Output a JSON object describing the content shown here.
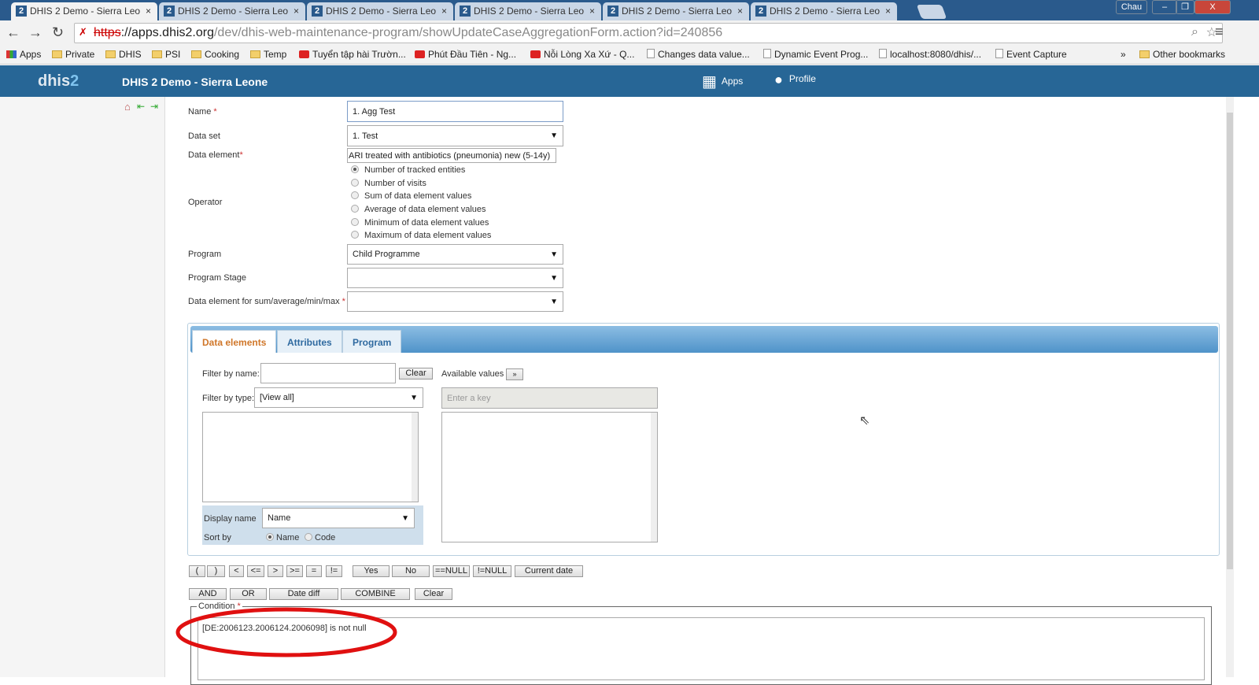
{
  "browser": {
    "tabs": [
      {
        "title": "DHIS 2 Demo - Sierra Leo",
        "active": true
      },
      {
        "title": "DHIS 2 Demo - Sierra Leo"
      },
      {
        "title": "DHIS 2 Demo - Sierra Leo"
      },
      {
        "title": "DHIS 2 Demo - Sierra Leo"
      },
      {
        "title": "DHIS 2 Demo - Sierra Leo"
      },
      {
        "title": "DHIS 2 Demo - Sierra Leo"
      }
    ],
    "favicon": "2",
    "close": "×",
    "user": "Chau",
    "url_scheme": "https",
    "url_host": "://apps.dhis2.org",
    "url_path": "/dev/dhis-web-maintenance-program/showUpdateCaseAggregationForm.action?id=240856",
    "bookmarks": [
      {
        "label": "Apps",
        "icon": "apps-grid"
      },
      {
        "label": "Private",
        "icon": "folder"
      },
      {
        "label": "DHIS",
        "icon": "folder"
      },
      {
        "label": "PSI",
        "icon": "folder"
      },
      {
        "label": "Cooking",
        "icon": "folder"
      },
      {
        "label": "Temp",
        "icon": "folder"
      },
      {
        "label": "Tuyển tập hài Trườn...",
        "icon": "youtube"
      },
      {
        "label": "Phút Đầu Tiên - Ng...",
        "icon": "youtube"
      },
      {
        "label": "Nỗi Lòng Xa Xứ - Q...",
        "icon": "youtube"
      },
      {
        "label": "Changes data value...",
        "icon": "page"
      },
      {
        "label": "Dynamic Event Prog...",
        "icon": "page"
      },
      {
        "label": "localhost:8080/dhis/...",
        "icon": "page"
      },
      {
        "label": "Event Capture",
        "icon": "page"
      }
    ],
    "more": "»",
    "other_bookmarks": "Other bookmarks"
  },
  "header": {
    "logo_main": "dhis",
    "logo_num": "2",
    "title": "DHIS 2 Demo - Sierra Leone",
    "apps": "Apps",
    "profile": "Profile"
  },
  "form": {
    "name_label": "Name",
    "name_value": "1. Agg Test",
    "dataset_label": "Data set",
    "dataset_value": "1. Test",
    "de_label": "Data element",
    "de_value": "ARI treated with antibiotics (pneumonia) new (5-14y)",
    "operator_label": "Operator",
    "operators": [
      "Number of tracked entities",
      "Number of visits",
      "Sum of data element values",
      "Average of data element values",
      "Minimum of data element values",
      "Maximum of data element values"
    ],
    "program_label": "Program",
    "program_value": "Child Programme",
    "stage_label": "Program Stage",
    "stage_value": "",
    "de_sum_label": "Data element for sum/average/min/max",
    "required": "*"
  },
  "panel": {
    "tabs": [
      "Data elements",
      "Attributes",
      "Program"
    ],
    "filter_name_label": "Filter by name:",
    "clear": "Clear",
    "available_values": "Available values",
    "move": "»",
    "filter_type_label": "Filter by type:",
    "filter_type_value": "[View all]",
    "key_placeholder": "Enter a key",
    "display_name_label": "Display name",
    "display_name_value": "Name",
    "sort_by_label": "Sort by",
    "sort_name": "Name",
    "sort_code": "Code"
  },
  "operators_row1": [
    "(",
    ")",
    "<",
    "<=",
    ">",
    ">=",
    "=",
    "!=",
    "Yes",
    "No",
    "==NULL",
    "!=NULL",
    "Current date"
  ],
  "operators_row2": [
    "AND",
    "OR",
    "Date diff",
    "COMBINE",
    "Clear"
  ],
  "condition": {
    "label": "Condition",
    "value": "[DE:2006123.2006124.2006098] is not null"
  },
  "colors": {
    "header": "#276696",
    "annotation": "#e01010"
  }
}
